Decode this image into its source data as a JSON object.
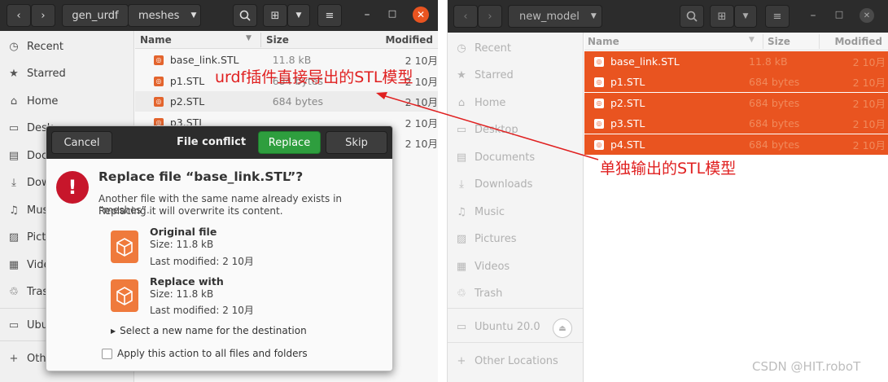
{
  "left_window": {
    "breadcrumbs": [
      "gen_urdf",
      "meshes"
    ],
    "sidebar": [
      {
        "label": "Recent",
        "icon": "clock-icon"
      },
      {
        "label": "Starred",
        "icon": "star-icon"
      },
      {
        "label": "Home",
        "icon": "home-icon"
      },
      {
        "label": "Desk",
        "icon": "desktop-icon"
      },
      {
        "label": "Doc",
        "icon": "document-icon"
      },
      {
        "label": "Dow",
        "icon": "download-icon"
      },
      {
        "label": "Mus",
        "icon": "music-icon"
      },
      {
        "label": "Pict",
        "icon": "picture-icon"
      },
      {
        "label": "Vide",
        "icon": "video-icon"
      },
      {
        "label": "Tras",
        "icon": "trash-icon"
      },
      {
        "label": "Ubu",
        "icon": "drive-icon"
      },
      {
        "label": "Othe",
        "icon": "plus-icon"
      }
    ],
    "columns": {
      "name": "Name",
      "size": "Size",
      "modified": "Modified"
    },
    "files": [
      {
        "name": "base_link.STL",
        "size": "11.8 kB",
        "modified": "2 10月"
      },
      {
        "name": "p1.STL",
        "size": "684 bytes",
        "modified": "2 10月"
      },
      {
        "name": "p2.STL",
        "size": "684 bytes",
        "modified": "2 10月"
      },
      {
        "name": "p3.STL",
        "size": "",
        "modified": "2 10月"
      },
      {
        "name": "",
        "size": "",
        "modified": "2 10月"
      }
    ]
  },
  "dialog": {
    "cancel": "Cancel",
    "title": "File conflict",
    "replace": "Replace",
    "skip": "Skip",
    "heading": "Replace file “base_link.STL”?",
    "description_line1": "Another file with the same name already exists in “meshes”.",
    "description_line2": "Replacing it will overwrite its content.",
    "original": {
      "title": "Original file",
      "size": "Size: 11.8 kB",
      "modified": "Last modified: 2 10月"
    },
    "replacement": {
      "title": "Replace with",
      "size": "Size: 11.8 kB",
      "modified": "Last modified: 2 10月"
    },
    "new_name_expander": "Select a new name for the destination",
    "apply_all": "Apply this action to all files and folders"
  },
  "right_window": {
    "breadcrumb": "new_model",
    "sidebar": [
      {
        "label": "Recent",
        "icon": "clock-icon"
      },
      {
        "label": "Starred",
        "icon": "star-icon"
      },
      {
        "label": "Home",
        "icon": "home-icon"
      },
      {
        "label": "Desktop",
        "icon": "desktop-icon"
      },
      {
        "label": "Documents",
        "icon": "document-icon"
      },
      {
        "label": "Downloads",
        "icon": "download-icon"
      },
      {
        "label": "Music",
        "icon": "music-icon"
      },
      {
        "label": "Pictures",
        "icon": "picture-icon"
      },
      {
        "label": "Videos",
        "icon": "video-icon"
      },
      {
        "label": "Trash",
        "icon": "trash-icon"
      },
      {
        "label": "Ubuntu 20.0",
        "icon": "drive-icon"
      },
      {
        "label": "Other Locations",
        "icon": "plus-icon"
      }
    ],
    "columns": {
      "name": "Name",
      "size": "Size",
      "modified": "Modified"
    },
    "files": [
      {
        "name": "base_link.STL",
        "size": "11.8 kB",
        "modified": "2 10月"
      },
      {
        "name": "p1.STL",
        "size": "684 bytes",
        "modified": "2 10月"
      },
      {
        "name": "p2.STL",
        "size": "684 bytes",
        "modified": "2 10月"
      },
      {
        "name": "p3.STL",
        "size": "684 bytes",
        "modified": "2 10月"
      },
      {
        "name": "p4.STL",
        "size": "684 bytes",
        "modified": "2 10月"
      }
    ]
  },
  "annotations": {
    "urdf_export": "urdf插件直接导出的STL模型",
    "single_export": "单独输出的STL模型",
    "watermark": "CSDN @HIT.roboT"
  },
  "colors": {
    "headerbar": "#2c2c2c",
    "selection": "#e95420",
    "replace_button": "#2e9e3e",
    "dialog_icon": "#c7162b",
    "annotation": "#e02020"
  }
}
